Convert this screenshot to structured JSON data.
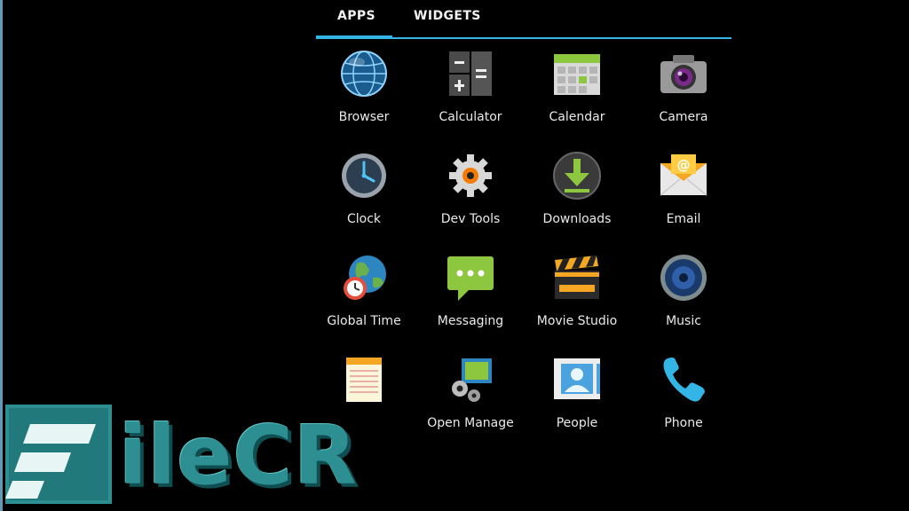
{
  "tabs": [
    {
      "label": "APPS",
      "selected": true
    },
    {
      "label": "WIDGETS",
      "selected": false
    }
  ],
  "apps": [
    {
      "label": "Browser",
      "icon": "globe-icon"
    },
    {
      "label": "Calculator",
      "icon": "calculator-icon"
    },
    {
      "label": "Calendar",
      "icon": "calendar-icon"
    },
    {
      "label": "Camera",
      "icon": "camera-icon"
    },
    {
      "label": "Clock",
      "icon": "clock-icon"
    },
    {
      "label": "Dev Tools",
      "icon": "gear-icon"
    },
    {
      "label": "Downloads",
      "icon": "download-icon"
    },
    {
      "label": "Email",
      "icon": "envelope-icon"
    },
    {
      "label": "Global Time",
      "icon": "world-clock-icon"
    },
    {
      "label": "Messaging",
      "icon": "message-bubble-icon"
    },
    {
      "label": "Movie Studio",
      "icon": "clapperboard-icon"
    },
    {
      "label": "Music",
      "icon": "speaker-icon"
    },
    {
      "label": "",
      "icon": "notepad-icon"
    },
    {
      "label": "Open Manage",
      "icon": "gears-folder-icon"
    },
    {
      "label": "People",
      "icon": "contact-card-icon"
    },
    {
      "label": "Phone",
      "icon": "phone-icon"
    }
  ],
  "watermark": {
    "text": "ileCR"
  },
  "colors": {
    "accent": "#33b5e5",
    "watermark": "#2d8f91"
  }
}
